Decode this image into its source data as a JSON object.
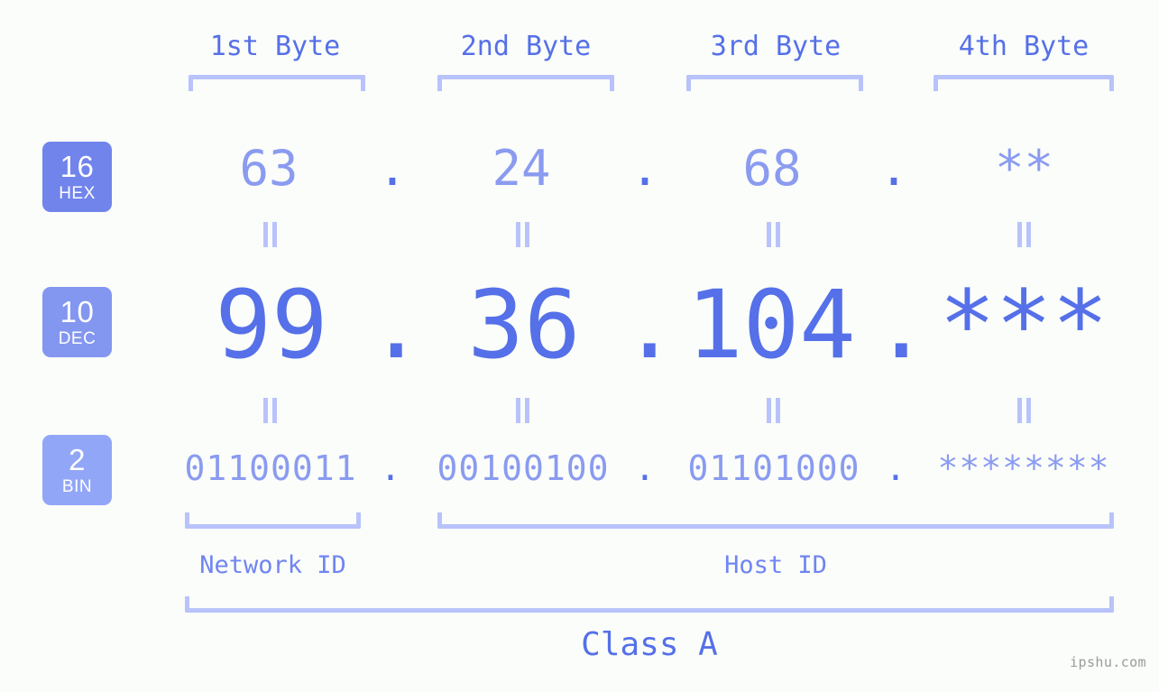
{
  "page": {
    "background_color": "#fbfdfa",
    "watermark": "ipshu.com"
  },
  "colors": {
    "accent_strong": "#5570e8",
    "accent_light": "#8a9bf0",
    "bracket": "#b8c3fb",
    "badge_hex": "#7184ec",
    "badge_dec": "#8397f0",
    "badge_bin": "#92a6f7"
  },
  "headers": [
    {
      "label": "1st Byte"
    },
    {
      "label": "2nd Byte"
    },
    {
      "label": "3rd Byte"
    },
    {
      "label": "4th Byte"
    }
  ],
  "bases": [
    {
      "number": "16",
      "name": "HEX"
    },
    {
      "number": "10",
      "name": "DEC"
    },
    {
      "number": "2",
      "name": "BIN"
    }
  ],
  "separator": ".",
  "rows": {
    "hex": {
      "base_number": "16",
      "base_name": "HEX",
      "values": [
        "63",
        "24",
        "68",
        "**"
      ]
    },
    "dec": {
      "base_number": "10",
      "base_name": "DEC",
      "values": [
        "99",
        "36",
        "104",
        "***"
      ]
    },
    "bin": {
      "base_number": "2",
      "base_name": "BIN",
      "values": [
        "01100011",
        "00100100",
        "01101000",
        "********"
      ]
    }
  },
  "segments": {
    "network_id": "Network ID",
    "host_id": "Host ID",
    "class": "Class A"
  }
}
